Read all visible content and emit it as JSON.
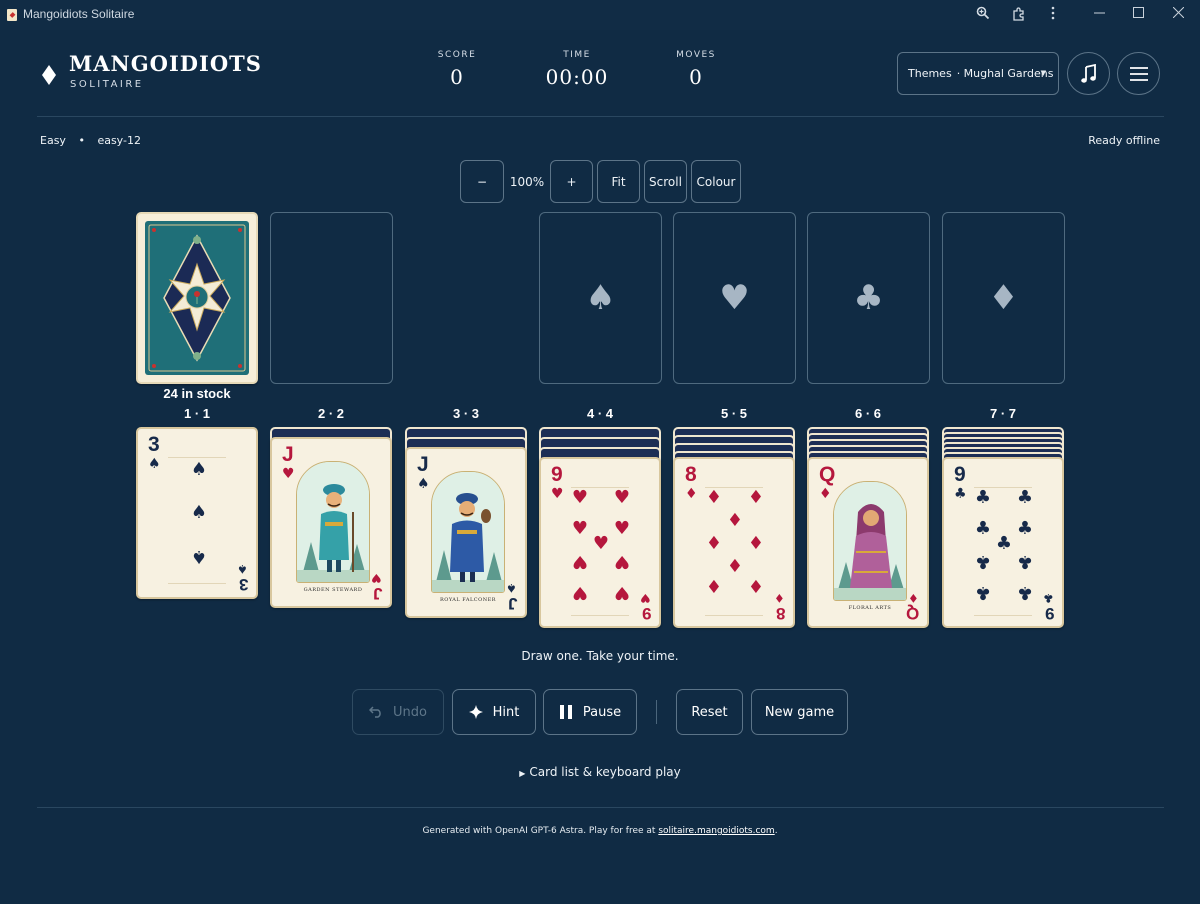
{
  "window": {
    "title": "Mangoidiots Solitaire"
  },
  "logo": {
    "title": "MANGOIDIOTS",
    "subtitle": "SOLITAIRE"
  },
  "stats": [
    {
      "label": "SCORE",
      "value": "0"
    },
    {
      "label": "TIME",
      "value": "00:00"
    },
    {
      "label": "MOVES",
      "value": "0"
    }
  ],
  "themes": {
    "label": "Themes",
    "selected": "· Mughal Gardens"
  },
  "game_meta": {
    "difficulty": "Easy",
    "separator": "•",
    "seed": "easy-12",
    "status": "Ready offline"
  },
  "zoom": {
    "minus": "−",
    "value": "100%",
    "plus": "+",
    "fit": "Fit",
    "scroll": "Scroll",
    "colour": "Colour"
  },
  "stock": {
    "label": "24 in stock"
  },
  "foundations": [
    {
      "suit": "♠"
    },
    {
      "suit": "♥"
    },
    {
      "suit": "♣"
    },
    {
      "suit": "♦"
    }
  ],
  "tableau": [
    {
      "label": "1 · 1",
      "hidden": 0,
      "rank": "3",
      "suit": "♠",
      "color": "black"
    },
    {
      "label": "2 · 2",
      "hidden": 1,
      "rank": "J",
      "suit": "♥",
      "color": "red",
      "caption": "GARDEN STEWARD"
    },
    {
      "label": "3 · 3",
      "hidden": 2,
      "rank": "J",
      "suit": "♠",
      "color": "black",
      "caption": "ROYAL FALCONER"
    },
    {
      "label": "4 · 4",
      "hidden": 3,
      "rank": "9",
      "suit": "♥",
      "color": "red"
    },
    {
      "label": "5 · 5",
      "hidden": 4,
      "rank": "8",
      "suit": "♦",
      "color": "red"
    },
    {
      "label": "6 · 6",
      "hidden": 5,
      "rank": "Q",
      "suit": "♦",
      "color": "red",
      "caption": "FLORAL ARTS"
    },
    {
      "label": "7 · 7",
      "hidden": 6,
      "rank": "9",
      "suit": "♣",
      "color": "black"
    }
  ],
  "tagline": "Draw one. Take your time.",
  "actions": {
    "undo": "Undo",
    "hint": "Hint",
    "pause": "Pause",
    "reset": "Reset",
    "new_game": "New game"
  },
  "details": {
    "label": "Card list & keyboard play"
  },
  "footer": {
    "text": "Generated with OpenAI GPT-6 Astra. Play for free at ",
    "link": "solitaire.mangoidiots.com",
    "end": "."
  },
  "colors": {
    "background": "#102b44",
    "card": "#f7f1e1",
    "red_suit": "#b5173d",
    "black_suit": "#172a4a",
    "card_back": "#1d2e55"
  }
}
